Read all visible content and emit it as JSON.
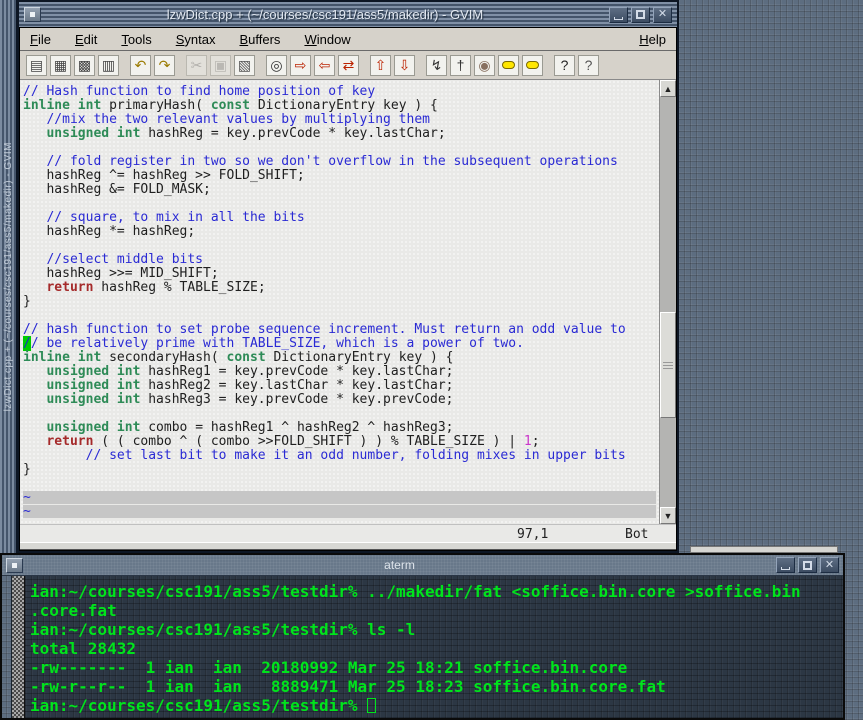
{
  "gvim": {
    "title": "lzwDict.cpp + (~/courses/csc191/ass5/makedir) - GVIM",
    "side_title": "lzwDict.cpp + (~/courses/csc191/ass5/makedir) - GVIM",
    "menus": [
      "File",
      "Edit",
      "Tools",
      "Syntax",
      "Buffers",
      "Window"
    ],
    "help_menu": "Help",
    "toolbar": [
      {
        "name": "open-file",
        "glyph": "▤",
        "color": "#444"
      },
      {
        "name": "save-file",
        "glyph": "▦",
        "color": "#444"
      },
      {
        "name": "save-all",
        "glyph": "▩",
        "color": "#444"
      },
      {
        "name": "print",
        "glyph": "▥",
        "color": "#444"
      },
      {
        "name": "undo",
        "glyph": "↶",
        "color": "#9a7a00",
        "gap": true
      },
      {
        "name": "redo",
        "glyph": "↷",
        "color": "#9a7a00"
      },
      {
        "name": "cut",
        "glyph": "✂",
        "color": "#888",
        "disabled": true,
        "gap": true
      },
      {
        "name": "copy",
        "glyph": "▣",
        "color": "#999",
        "disabled": true
      },
      {
        "name": "paste",
        "glyph": "▧",
        "color": "#555"
      },
      {
        "name": "find",
        "glyph": "◎",
        "color": "#333",
        "gap": true
      },
      {
        "name": "find-next",
        "glyph": "⇨",
        "color": "#bb2200"
      },
      {
        "name": "find-prev",
        "glyph": "⇦",
        "color": "#bb2200"
      },
      {
        "name": "find-replace",
        "glyph": "⇄",
        "color": "#bb2200"
      },
      {
        "name": "load-session",
        "glyph": "⇧",
        "color": "#bb2200",
        "gap": true
      },
      {
        "name": "save-session",
        "glyph": "⇩",
        "color": "#bb2200"
      },
      {
        "name": "run-script",
        "glyph": "↯",
        "color": "#333",
        "gap": true
      },
      {
        "name": "make",
        "glyph": "†",
        "color": "#333"
      },
      {
        "name": "shell",
        "glyph": "◉",
        "color": "#887060"
      },
      {
        "name": "build-tags",
        "glyph": "",
        "color": "#333",
        "kind": "tag"
      },
      {
        "name": "tag-jump",
        "glyph": "",
        "color": "#333",
        "kind": "tag"
      },
      {
        "name": "help",
        "glyph": "?",
        "color": "#222",
        "gap": true
      },
      {
        "name": "find-help",
        "glyph": "?",
        "color": "#555"
      }
    ],
    "code_lines": [
      {
        "s": [
          [
            "// Hash function to find home position of key",
            "c"
          ]
        ]
      },
      {
        "s": [
          [
            "inline int",
            "k"
          ],
          [
            " primaryHash( ",
            "n"
          ],
          [
            "const",
            "k"
          ],
          [
            " DictionaryEntry key ) {",
            "n"
          ]
        ]
      },
      {
        "s": [
          [
            "   //mix the two relevant values by multiplying them",
            "c"
          ]
        ]
      },
      {
        "s": [
          [
            "   ",
            "n"
          ],
          [
            "unsigned int",
            "k"
          ],
          [
            " hashReg = key.prevCode * key.lastChar;",
            "n"
          ]
        ]
      },
      {
        "s": []
      },
      {
        "s": [
          [
            "   // fold register in two so we don't overflow in the subsequent operations",
            "c"
          ]
        ]
      },
      {
        "s": [
          [
            "   hashReg ^= hashReg >> FOLD_SHIFT;",
            "n"
          ]
        ]
      },
      {
        "s": [
          [
            "   hashReg &= FOLD_MASK;",
            "n"
          ]
        ]
      },
      {
        "s": []
      },
      {
        "s": [
          [
            "   // square, to mix in all the bits",
            "c"
          ]
        ]
      },
      {
        "s": [
          [
            "   hashReg *= hashReg;",
            "n"
          ]
        ]
      },
      {
        "s": []
      },
      {
        "s": [
          [
            "   //select middle bits",
            "c"
          ]
        ]
      },
      {
        "s": [
          [
            "   hashReg >>= MID_SHIFT;",
            "n"
          ]
        ]
      },
      {
        "s": [
          [
            "   ",
            "n"
          ],
          [
            "return",
            "r"
          ],
          [
            " hashReg % TABLE_SIZE;",
            "n"
          ]
        ]
      },
      {
        "s": [
          [
            "}",
            "n"
          ]
        ]
      },
      {
        "s": []
      },
      {
        "s": [
          [
            "// hash function to set probe sequence increment. Must return an odd value to",
            "c"
          ]
        ]
      },
      {
        "s": [
          [
            "/",
            "cur"
          ],
          [
            "/ be relatively prime with TABLE_SIZE, which is a power of two.",
            "c"
          ]
        ]
      },
      {
        "s": [
          [
            "inline int",
            "k"
          ],
          [
            " secondaryHash( ",
            "n"
          ],
          [
            "const",
            "k"
          ],
          [
            " DictionaryEntry key ) {",
            "n"
          ]
        ]
      },
      {
        "s": [
          [
            "   ",
            "n"
          ],
          [
            "unsigned int",
            "k"
          ],
          [
            " hashReg1 = key.prevCode * key.lastChar;",
            "n"
          ]
        ]
      },
      {
        "s": [
          [
            "   ",
            "n"
          ],
          [
            "unsigned int",
            "k"
          ],
          [
            " hashReg2 = key.lastChar * key.lastChar;",
            "n"
          ]
        ]
      },
      {
        "s": [
          [
            "   ",
            "n"
          ],
          [
            "unsigned int",
            "k"
          ],
          [
            " hashReg3 = key.prevCode * key.prevCode;",
            "n"
          ]
        ]
      },
      {
        "s": []
      },
      {
        "s": [
          [
            "   ",
            "n"
          ],
          [
            "unsigned int",
            "k"
          ],
          [
            " combo = hashReg1 ^ hashReg2 ^ hashReg3;",
            "n"
          ]
        ]
      },
      {
        "s": [
          [
            "   ",
            "n"
          ],
          [
            "return",
            "r"
          ],
          [
            " ( ( combo ^ ( combo >>FOLD_SHIFT ) ) % TABLE_SIZE ) | ",
            "n"
          ],
          [
            "1",
            "m"
          ],
          [
            ";",
            "n"
          ]
        ]
      },
      {
        "s": [
          [
            "        // set last bit to make it an odd number, folding mixes in upper bits",
            "c"
          ]
        ]
      },
      {
        "s": [
          [
            "}",
            "n"
          ]
        ]
      },
      {
        "s": []
      },
      {
        "s": [
          [
            "~",
            "t"
          ]
        ],
        "band": true
      },
      {
        "s": [
          [
            "~",
            "t"
          ]
        ],
        "band": true
      }
    ],
    "ruler": "97,1",
    "scroll_position": "Bot",
    "colors": {
      "comment": "#2a2ad4",
      "keyword": "#2e8b57",
      "statement": "#a52a2a",
      "number": "#cb36cb",
      "cursor": "#00cc00",
      "text_bg": "#e9e9e7",
      "chrome_bg": "#d6d2ca"
    }
  },
  "aterm": {
    "title": "aterm",
    "lines": [
      "ian:~/courses/csc191/ass5/testdir% ../makedir/fat <soffice.bin.core >soffice.bin",
      ".core.fat",
      "ian:~/courses/csc191/ass5/testdir% ls -l",
      "total 28432",
      "-rw-------  1 ian  ian  20180992 Mar 25 18:21 soffice.bin.core",
      "-rw-r--r--  1 ian  ian   8889471 Mar 25 18:23 soffice.bin.core.fat"
    ],
    "last_prompt": "ian:~/courses/csc191/ass5/testdir% ",
    "colors": {
      "text": "#00e41c",
      "bg": "#2c3744",
      "titlebar": "#68788a"
    }
  }
}
